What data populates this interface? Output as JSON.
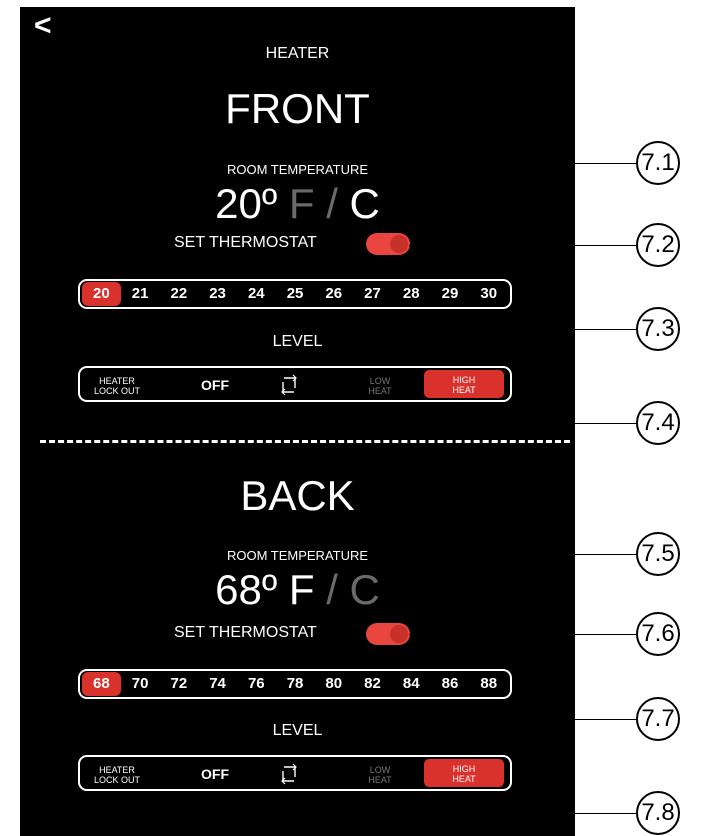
{
  "header": {
    "back_glyph": "<",
    "title": "HEATER"
  },
  "front": {
    "title": "FRONT",
    "room_temp_label": "ROOM TEMPERATURE",
    "temp_value": "20º",
    "unit_f": "F",
    "unit_sep": "/",
    "unit_c": "C",
    "active_unit": "C",
    "thermostat_label": "SET THERMOSTAT",
    "thermostat_on": true,
    "scale": [
      "20",
      "21",
      "22",
      "23",
      "24",
      "25",
      "26",
      "27",
      "28",
      "29",
      "30"
    ],
    "scale_selected": "20",
    "level_label": "LEVEL",
    "level": {
      "lockout_1": "HEATER",
      "lockout_2": "LOCK OUT",
      "off": "OFF",
      "low_1": "LOW",
      "low_2": "HEAT",
      "high_1": "HIGH",
      "high_2": "HEAT",
      "selected": "HIGH HEAT"
    }
  },
  "back": {
    "title": "BACK",
    "room_temp_label": "ROOM TEMPERATURE",
    "temp_value": "68º",
    "unit_f": "F",
    "unit_sep": "/",
    "unit_c": "C",
    "active_unit": "F",
    "thermostat_label": "SET THERMOSTAT",
    "thermostat_on": true,
    "scale": [
      "68",
      "70",
      "72",
      "74",
      "76",
      "78",
      "80",
      "82",
      "84",
      "86",
      "88"
    ],
    "scale_selected": "68",
    "level_label": "LEVEL",
    "level": {
      "lockout_1": "HEATER",
      "lockout_2": "LOCK OUT",
      "off": "OFF",
      "low_1": "LOW",
      "low_2": "HEAT",
      "high_1": "HIGH",
      "high_2": "HEAT",
      "selected": "HIGH HEAT"
    }
  },
  "callouts": [
    "7.1",
    "7.2",
    "7.3",
    "7.4",
    "7.5",
    "7.6",
    "7.7",
    "7.8"
  ],
  "colors": {
    "accent": "#d9312b",
    "toggle": "#e8463f",
    "background": "#000000"
  }
}
